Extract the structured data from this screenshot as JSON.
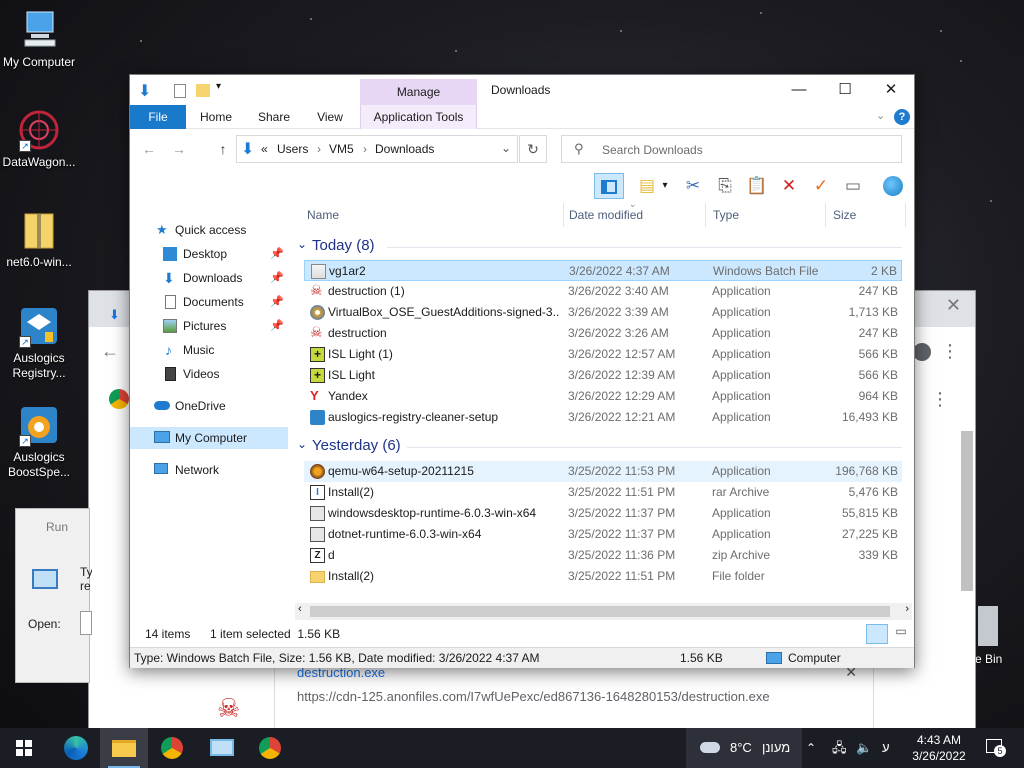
{
  "desktop": {
    "icons": [
      {
        "label": "My Computer"
      },
      {
        "label": "DataWagon..."
      },
      {
        "label": "net6.0-win..."
      },
      {
        "label": "Auslogics Registry..."
      },
      {
        "label": "Auslogics BoostSpe..."
      }
    ],
    "right_label": "e Bin"
  },
  "run_dialog": {
    "title": "Run",
    "open_label": "Open:",
    "text_fragment": "Ty re"
  },
  "chrome_download": {
    "name": "destruction.exe",
    "url": "https://cdn-125.anonfiles.com/I7wfUePexc/ed867136-1648280153/destruction.exe",
    "footer_fragment": "... ..."
  },
  "explorer": {
    "title": "Downloads",
    "manage_tab": "Manage",
    "ribbon_tabs": [
      "File",
      "Home",
      "Share",
      "View",
      "Application Tools"
    ],
    "breadcrumb": [
      "Users",
      "VM5",
      "Downloads"
    ],
    "breadcrumb_prefix": "«",
    "search_placeholder": "Search Downloads",
    "columns": {
      "name": "Name",
      "date": "Date modified",
      "type": "Type",
      "size": "Size"
    },
    "nav": [
      {
        "label": "Quick access",
        "icon": "star-icon"
      },
      {
        "label": "Desktop",
        "icon": "desktop-icon"
      },
      {
        "label": "Downloads",
        "icon": "download-icon"
      },
      {
        "label": "Documents",
        "icon": "document-icon"
      },
      {
        "label": "Pictures",
        "icon": "picture-icon"
      },
      {
        "label": "Music",
        "icon": "music-icon"
      },
      {
        "label": "Videos",
        "icon": "video-icon"
      },
      {
        "label": "OneDrive",
        "icon": "cloud-icon"
      },
      {
        "label": "My Computer",
        "icon": "computer-icon"
      },
      {
        "label": "Network",
        "icon": "network-icon"
      }
    ],
    "groups": [
      {
        "label": "Today (8)",
        "files": [
          {
            "name": "vg1ar2",
            "date": "3/26/2022 4:37 AM",
            "type": "Windows Batch File",
            "size": "2 KB",
            "icon": "batch-file-icon"
          },
          {
            "name": "destruction (1)",
            "date": "3/26/2022 3:40 AM",
            "type": "Application",
            "size": "247 KB",
            "icon": "skull-icon"
          },
          {
            "name": "VirtualBox_OSE_GuestAdditions-signed-3...",
            "date": "3/26/2022 3:39 AM",
            "type": "Application",
            "size": "1,713 KB",
            "icon": "installer-disc-icon"
          },
          {
            "name": "destruction",
            "date": "3/26/2022 3:26 AM",
            "type": "Application",
            "size": "247 KB",
            "icon": "skull-icon"
          },
          {
            "name": "ISL Light (1)",
            "date": "3/26/2022 12:57 AM",
            "type": "Application",
            "size": "566 KB",
            "icon": "isl-light-icon"
          },
          {
            "name": "ISL Light",
            "date": "3/26/2022 12:39 AM",
            "type": "Application",
            "size": "566 KB",
            "icon": "isl-light-icon"
          },
          {
            "name": "Yandex",
            "date": "3/26/2022 12:29 AM",
            "type": "Application",
            "size": "964 KB",
            "icon": "yandex-icon"
          },
          {
            "name": "auslogics-registry-cleaner-setup",
            "date": "3/26/2022 12:21 AM",
            "type": "Application",
            "size": "16,493 KB",
            "icon": "auslogics-icon"
          }
        ]
      },
      {
        "label": "Yesterday (6)",
        "files": [
          {
            "name": "qemu-w64-setup-20211215",
            "date": "3/25/2022 11:53 PM",
            "type": "Application",
            "size": "196,768 KB",
            "icon": "qemu-icon"
          },
          {
            "name": "Install(2)",
            "date": "3/25/2022 11:51 PM",
            "type": "rar Archive",
            "size": "5,476 KB",
            "icon": "archive-icon"
          },
          {
            "name": "windowsdesktop-runtime-6.0.3-win-x64",
            "date": "3/25/2022 11:37 PM",
            "type": "Application",
            "size": "55,815 KB",
            "icon": "installer-icon"
          },
          {
            "name": "dotnet-runtime-6.0.3-win-x64",
            "date": "3/25/2022 11:37 PM",
            "type": "Application",
            "size": "27,225 KB",
            "icon": "installer-icon"
          },
          {
            "name": "d",
            "date": "3/25/2022 11:36 PM",
            "type": "zip Archive",
            "size": "339 KB",
            "icon": "zip-icon"
          },
          {
            "name": "Install(2)",
            "date": "3/25/2022 11:51 PM",
            "type": "File folder",
            "size": "",
            "icon": "folder-icon"
          }
        ]
      }
    ],
    "status": {
      "items": "14 items",
      "selected": "1 item selected  1.56 KB"
    },
    "details": {
      "info": "Type: Windows Batch File, Size: 1.56 KB, Date modified: 3/26/2022 4:37 AM",
      "size": "1.56 KB",
      "location": "Computer"
    }
  },
  "taskbar": {
    "weather": "8°C",
    "weather_text": "מעונן",
    "time": "4:43 AM",
    "date": "3/26/2022",
    "notifications": "5"
  }
}
